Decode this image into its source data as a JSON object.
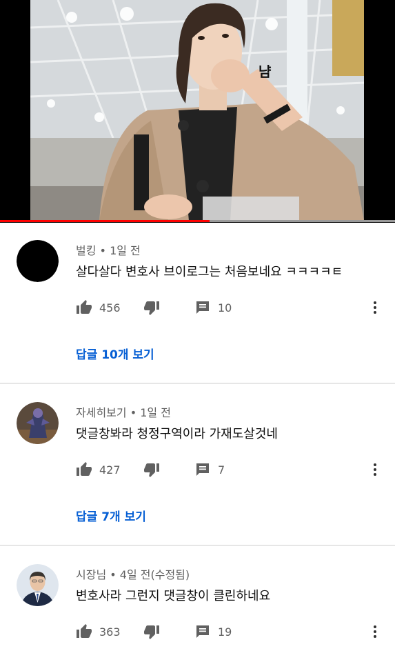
{
  "video": {
    "overlay_caption": "냠",
    "progress": 0.53,
    "progress_color": "#ff0000"
  },
  "comments": [
    {
      "author": "벌킹",
      "time": "• 1일 전",
      "text": "살다살다 변호사 브이로그는 처음보네요 ㅋㅋㅋㅋㅌ",
      "likes": "456",
      "replies_count": "10",
      "view_replies": "답글 10개 보기",
      "avatar": "black-circle-avatar"
    },
    {
      "author": "자세히보기",
      "time": "• 1일 전",
      "text": "댓글창봐라 청정구역이라 가재도살것네",
      "likes": "427",
      "replies_count": "7",
      "view_replies": "답글 7개 보기",
      "avatar": "game-character-avatar"
    },
    {
      "author": "시장님",
      "time": "• 4일 전(수정됨)",
      "text": "변호사라 그런지 댓글창이 클린하네요",
      "likes": "363",
      "replies_count": "19",
      "avatar": "suited-man-avatar"
    }
  ],
  "icons": {
    "like": "thumbs-up-icon",
    "dislike": "thumbs-down-icon",
    "reply": "comment-icon",
    "more": "more-vertical-icon"
  },
  "colors": {
    "link": "#065fd4",
    "meta": "#606060"
  }
}
